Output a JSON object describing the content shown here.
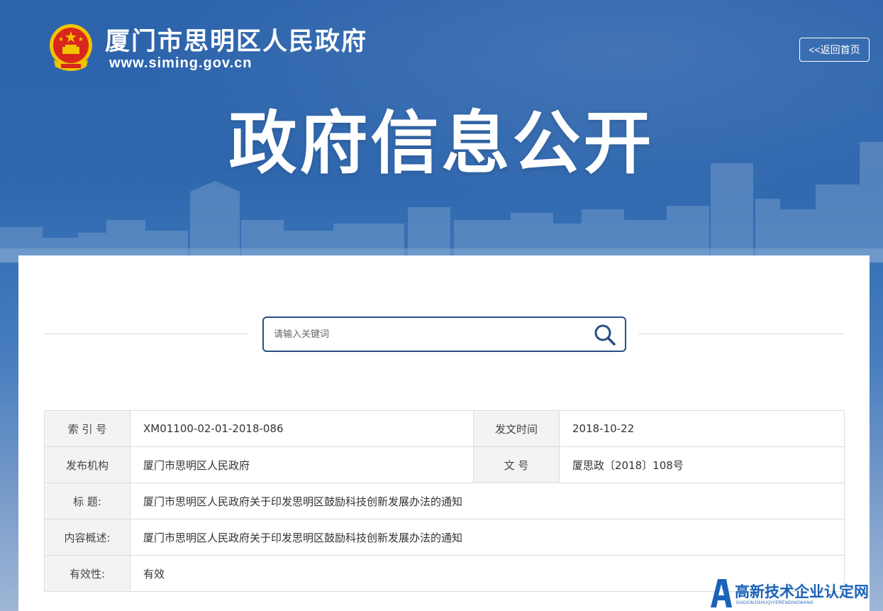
{
  "header": {
    "site_title": "厦门市思明区人民政府",
    "site_url": "www.siming.gov.cn",
    "home_button_label": "<<返回首页",
    "banner_title": "政府信息公开"
  },
  "search": {
    "placeholder": "请输入关键词",
    "value": ""
  },
  "info_table": {
    "index_label": "索 引 号",
    "index_value": "XM01100-02-01-2018-086",
    "date_label": "发文时间",
    "date_value": "2018-10-22",
    "publisher_label": "发布机构",
    "publisher_value": "厦门市思明区人民政府",
    "doc_no_label": "文 号",
    "doc_no_value": "厦思政〔2018〕108号",
    "title_label": "标 题:",
    "title_value": "厦门市思明区人民政府关于印发思明区鼓励科技创新发展办法的通知",
    "summary_label": "内容概述:",
    "summary_value": "厦门市思明区人民政府关于印发思明区鼓励科技创新发展办法的通知",
    "validity_label": "有效性:",
    "validity_value": "有效"
  },
  "watermark": {
    "text": "高新技术企业认定网",
    "subtext": "GAOXINJISHUQIYERENDINGWANG"
  },
  "colors": {
    "banner_blue": "#2f67ae",
    "search_border": "#274f86",
    "label_bg": "#f3f3f3",
    "watermark_blue": "#1a63b8"
  }
}
